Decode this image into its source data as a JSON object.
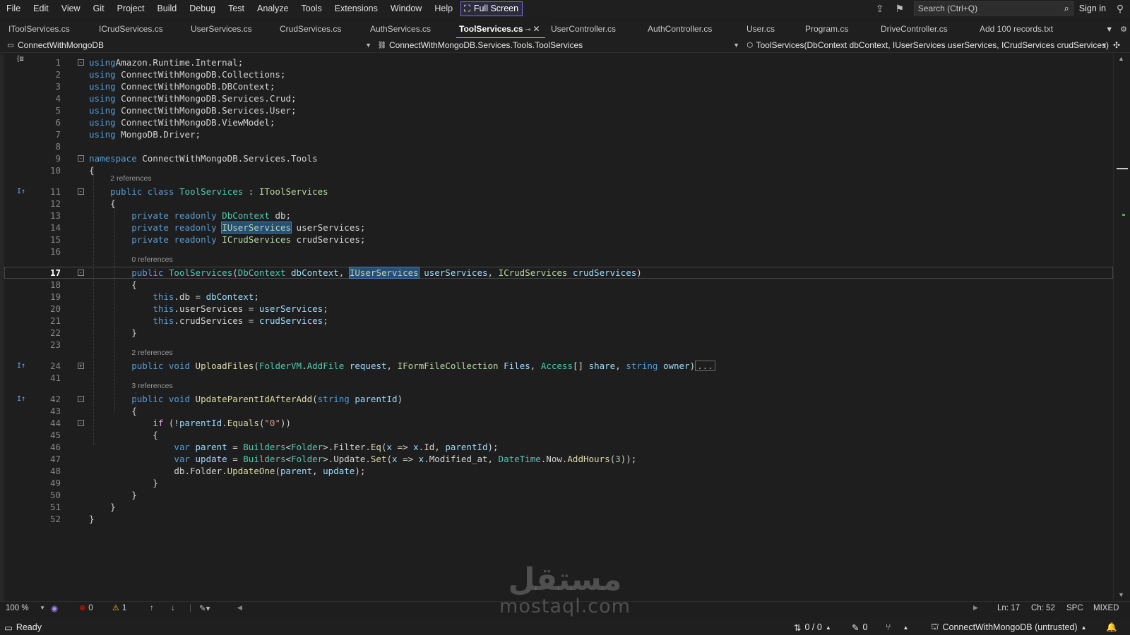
{
  "menubar": {
    "items": [
      "File",
      "Edit",
      "View",
      "Git",
      "Project",
      "Build",
      "Debug",
      "Test",
      "Analyze",
      "Tools",
      "Extensions",
      "Window",
      "Help"
    ],
    "full_screen": "Full Screen",
    "search_placeholder": "Search (Ctrl+Q)",
    "sign_in": "Sign in"
  },
  "tabs": [
    {
      "label": "IToolServices.cs",
      "active": false
    },
    {
      "label": "ICrudServices.cs",
      "active": false
    },
    {
      "label": "UserServices.cs",
      "active": false
    },
    {
      "label": "CrudServices.cs",
      "active": false
    },
    {
      "label": "AuthServices.cs",
      "active": false
    },
    {
      "label": "ToolServices.cs",
      "active": true
    },
    {
      "label": "UserController.cs",
      "active": false
    },
    {
      "label": "AuthController.cs",
      "active": false
    },
    {
      "label": "User.cs",
      "active": false
    },
    {
      "label": "Program.cs",
      "active": false
    },
    {
      "label": "DriveController.cs",
      "active": false
    },
    {
      "label": "Add 100 records.txt",
      "active": false
    }
  ],
  "navbar": {
    "project": "ConnectWithMongoDB",
    "type": "ConnectWithMongoDB.Services.Tools.ToolServices",
    "member": "ToolServices(DbContext dbContext, IUserServices userServices, ICrudServices crudServices)"
  },
  "editor": {
    "current_line": "17",
    "lines": [
      {
        "num": "1",
        "fold": "-",
        "tokens": [
          [
            "kw",
            "using"
          ],
          [
            "",
            "Amazon.Runtime.Internal;"
          ]
        ]
      },
      {
        "num": "2",
        "tokens": [
          [
            "kw",
            "using"
          ],
          [
            "",
            " ConnectWithMongoDB.Collections;"
          ]
        ]
      },
      {
        "num": "3",
        "tokens": [
          [
            "kw",
            "using"
          ],
          [
            "",
            " ConnectWithMongoDB.DBContext;"
          ]
        ]
      },
      {
        "num": "4",
        "tokens": [
          [
            "kw",
            "using"
          ],
          [
            "",
            " ConnectWithMongoDB.Services.Crud;"
          ]
        ]
      },
      {
        "num": "5",
        "tokens": [
          [
            "kw",
            "using"
          ],
          [
            "",
            " ConnectWithMongoDB.Services.User;"
          ]
        ]
      },
      {
        "num": "6",
        "tokens": [
          [
            "kw",
            "using"
          ],
          [
            "",
            " ConnectWithMongoDB.ViewModel;"
          ]
        ]
      },
      {
        "num": "7",
        "tokens": [
          [
            "kw",
            "using"
          ],
          [
            "",
            " MongoDB.Driver;"
          ]
        ]
      },
      {
        "num": "8",
        "tokens": []
      },
      {
        "num": "9",
        "fold": "-",
        "tokens": [
          [
            "kw",
            "namespace"
          ],
          [
            "",
            " ConnectWithMongoDB.Services.Tools"
          ]
        ]
      },
      {
        "num": "10",
        "tokens": [
          [
            "",
            "{"
          ]
        ]
      },
      {
        "num": "11",
        "fold": "-",
        "glyph": "I↑",
        "lens": "2 references",
        "tokens": [
          [
            "",
            "    "
          ],
          [
            "kw",
            "public"
          ],
          [
            "",
            " "
          ],
          [
            "kw",
            "class"
          ],
          [
            "",
            " "
          ],
          [
            "ty",
            "ToolServices"
          ],
          [
            "",
            " : "
          ],
          [
            "ifc",
            "IToolServices"
          ]
        ]
      },
      {
        "num": "12",
        "tokens": [
          [
            "",
            "    {"
          ]
        ]
      },
      {
        "num": "13",
        "tokens": [
          [
            "",
            "        "
          ],
          [
            "kw",
            "private"
          ],
          [
            "",
            " "
          ],
          [
            "kw",
            "readonly"
          ],
          [
            "",
            " "
          ],
          [
            "ty",
            "DbContext"
          ],
          [
            "",
            " db;"
          ]
        ]
      },
      {
        "num": "14",
        "tokens": [
          [
            "",
            "        "
          ],
          [
            "kw",
            "private"
          ],
          [
            "",
            " "
          ],
          [
            "kw",
            "readonly"
          ],
          [
            "",
            " "
          ],
          [
            "ifc hl",
            "IUserServices"
          ],
          [
            "",
            " userServices;"
          ]
        ]
      },
      {
        "num": "15",
        "tokens": [
          [
            "",
            "        "
          ],
          [
            "kw",
            "private"
          ],
          [
            "",
            " "
          ],
          [
            "kw",
            "readonly"
          ],
          [
            "",
            " "
          ],
          [
            "ifc",
            "ICrudServices"
          ],
          [
            "",
            " crudServices;"
          ]
        ]
      },
      {
        "num": "16",
        "tokens": []
      },
      {
        "num": "17",
        "fold": "-",
        "lens": "0 references",
        "current": true,
        "tokens": [
          [
            "",
            "        "
          ],
          [
            "kw",
            "public"
          ],
          [
            "",
            " "
          ],
          [
            "ty",
            "ToolServices"
          ],
          [
            "",
            "("
          ],
          [
            "ty",
            "DbContext"
          ],
          [
            "",
            " "
          ],
          [
            "pm",
            "dbContext"
          ],
          [
            "",
            ", "
          ],
          [
            "ifc hl",
            "IUserServices"
          ],
          [
            "",
            " "
          ],
          [
            "pm",
            "userServices"
          ],
          [
            "",
            ", "
          ],
          [
            "ifc",
            "ICrudServices"
          ],
          [
            "",
            " "
          ],
          [
            "pm",
            "crudServices"
          ],
          [
            "",
            ")"
          ]
        ]
      },
      {
        "num": "18",
        "tokens": [
          [
            "",
            "        {"
          ]
        ]
      },
      {
        "num": "19",
        "tokens": [
          [
            "",
            "            "
          ],
          [
            "kw",
            "this"
          ],
          [
            "",
            ".db = "
          ],
          [
            "pm",
            "dbContext"
          ],
          [
            "",
            ";"
          ]
        ]
      },
      {
        "num": "20",
        "tokens": [
          [
            "",
            "            "
          ],
          [
            "kw",
            "this"
          ],
          [
            "",
            ".userServices = "
          ],
          [
            "pm",
            "userServices"
          ],
          [
            "",
            ";"
          ]
        ]
      },
      {
        "num": "21",
        "tokens": [
          [
            "",
            "            "
          ],
          [
            "kw",
            "this"
          ],
          [
            "",
            ".crudServices = "
          ],
          [
            "pm",
            "crudServices"
          ],
          [
            "",
            ";"
          ]
        ]
      },
      {
        "num": "22",
        "tokens": [
          [
            "",
            "        }"
          ]
        ]
      },
      {
        "num": "23",
        "tokens": []
      },
      {
        "num": "24",
        "fold": "+",
        "glyph": "I↑",
        "lens": "2 references",
        "tokens": [
          [
            "",
            "        "
          ],
          [
            "kw",
            "public"
          ],
          [
            "",
            " "
          ],
          [
            "kw",
            "void"
          ],
          [
            "",
            " "
          ],
          [
            "mt",
            "UploadFiles"
          ],
          [
            "",
            "("
          ],
          [
            "ty",
            "FolderVM"
          ],
          [
            "",
            "."
          ],
          [
            "ty",
            "AddFile"
          ],
          [
            "",
            " "
          ],
          [
            "pm",
            "request"
          ],
          [
            "",
            ", "
          ],
          [
            "ifc",
            "IFormFileCollection"
          ],
          [
            "",
            " "
          ],
          [
            "pm",
            "Files"
          ],
          [
            "",
            ", "
          ],
          [
            "ty",
            "Access"
          ],
          [
            "",
            "[] "
          ],
          [
            "pm",
            "share"
          ],
          [
            "",
            ", "
          ],
          [
            "kw",
            "string"
          ],
          [
            "",
            " "
          ],
          [
            "pm",
            "owner"
          ],
          [
            "",
            ")"
          ],
          [
            "collapsed",
            "..."
          ]
        ]
      },
      {
        "num": "41",
        "tokens": []
      },
      {
        "num": "42",
        "fold": "-",
        "glyph": "I↑",
        "lens": "3 references",
        "tokens": [
          [
            "",
            "        "
          ],
          [
            "kw",
            "public"
          ],
          [
            "",
            " "
          ],
          [
            "kw",
            "void"
          ],
          [
            "",
            " "
          ],
          [
            "mt",
            "UpdateParentIdAfterAdd"
          ],
          [
            "",
            "("
          ],
          [
            "kw",
            "string"
          ],
          [
            "",
            " "
          ],
          [
            "pm",
            "parentId"
          ],
          [
            "",
            ")"
          ]
        ]
      },
      {
        "num": "43",
        "tokens": [
          [
            "",
            "        {"
          ]
        ]
      },
      {
        "num": "44",
        "fold": "-",
        "tokens": [
          [
            "",
            "            "
          ],
          [
            "ctl",
            "if"
          ],
          [
            "",
            " (!"
          ],
          [
            "pm",
            "parentId"
          ],
          [
            "",
            "."
          ],
          [
            "mt",
            "Equals"
          ],
          [
            "",
            "("
          ],
          [
            "st",
            "\"0\""
          ],
          [
            "",
            "))"
          ]
        ]
      },
      {
        "num": "45",
        "tokens": [
          [
            "",
            "            {"
          ]
        ]
      },
      {
        "num": "46",
        "tokens": [
          [
            "",
            "                "
          ],
          [
            "kw",
            "var"
          ],
          [
            "",
            " "
          ],
          [
            "pm",
            "parent"
          ],
          [
            "",
            " = "
          ],
          [
            "ty",
            "Builders"
          ],
          [
            "",
            "<"
          ],
          [
            "ty",
            "Folder"
          ],
          [
            "",
            ">.Filter."
          ],
          [
            "mt",
            "Eq"
          ],
          [
            "",
            "("
          ],
          [
            "pm",
            "x"
          ],
          [
            "",
            " => "
          ],
          [
            "pm",
            "x"
          ],
          [
            "",
            ".Id, "
          ],
          [
            "pm",
            "parentId"
          ],
          [
            "",
            ");"
          ]
        ]
      },
      {
        "num": "47",
        "tokens": [
          [
            "",
            "                "
          ],
          [
            "kw",
            "var"
          ],
          [
            "",
            " "
          ],
          [
            "pm",
            "update"
          ],
          [
            "",
            " = "
          ],
          [
            "ty",
            "Builders"
          ],
          [
            "",
            "<"
          ],
          [
            "ty",
            "Folder"
          ],
          [
            "",
            ">.Update."
          ],
          [
            "mt",
            "Set"
          ],
          [
            "",
            "("
          ],
          [
            "pm",
            "x"
          ],
          [
            "",
            " => "
          ],
          [
            "pm",
            "x"
          ],
          [
            "",
            ".Modified_at, "
          ],
          [
            "ty",
            "DateTime"
          ],
          [
            "",
            ".Now."
          ],
          [
            "mt",
            "AddHours"
          ],
          [
            "",
            "("
          ],
          [
            "nm",
            "3"
          ],
          [
            "",
            "));"
          ]
        ]
      },
      {
        "num": "48",
        "tokens": [
          [
            "",
            "                db.Folder."
          ],
          [
            "mt",
            "UpdateOne"
          ],
          [
            "",
            "("
          ],
          [
            "pm",
            "parent"
          ],
          [
            "",
            ", "
          ],
          [
            "pm",
            "update"
          ],
          [
            "",
            ");"
          ]
        ]
      },
      {
        "num": "49",
        "tokens": [
          [
            "",
            "            }"
          ]
        ]
      },
      {
        "num": "50",
        "tokens": [
          [
            "",
            "        }"
          ]
        ]
      },
      {
        "num": "51",
        "tokens": [
          [
            "",
            "    }"
          ]
        ]
      },
      {
        "num": "52",
        "tokens": [
          [
            "",
            "}"
          ]
        ]
      }
    ]
  },
  "editor_status": {
    "zoom": "100 %",
    "errors": "0",
    "warnings": "1",
    "position_line": "Ln: 17",
    "position_char": "Ch: 52",
    "whitespace": "SPC",
    "line_endings": "MIXED"
  },
  "statusbar": {
    "state": "Ready",
    "changes": "0 / 0",
    "edits": "0",
    "repo": "ConnectWithMongoDB (untrusted)"
  },
  "watermark": {
    "arabic": "مستقل",
    "latin": "mostaql.com"
  },
  "colors": {
    "background": "#1e1e1e",
    "keyword": "#569cd6",
    "type": "#4ec9b0",
    "interface": "#b8d7a3",
    "method": "#dcdcaa",
    "parameter": "#9cdcfe",
    "string": "#d69d85",
    "accent": "#c2b6ff"
  }
}
